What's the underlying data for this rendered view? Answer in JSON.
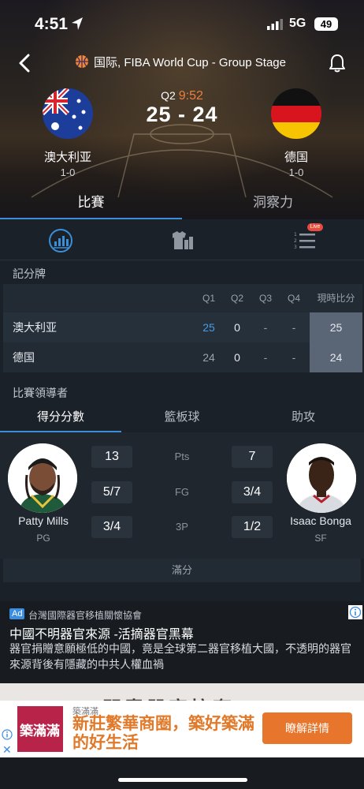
{
  "status_bar": {
    "time": "4:51",
    "network": "5G",
    "battery": "49"
  },
  "header": {
    "league": "国际, FIBA World Cup - Group Stage"
  },
  "match": {
    "period": "Q2",
    "clock": "9:52",
    "score": "25 - 24",
    "home": {
      "name": "澳大利亚",
      "record": "1-0"
    },
    "away": {
      "name": "德国",
      "record": "1-0"
    }
  },
  "main_tabs": [
    {
      "label": "比賽"
    },
    {
      "label": "洞察力"
    }
  ],
  "icon_tabs": {
    "live_badge": "Live"
  },
  "scoreboard": {
    "title": "記分牌",
    "headers": [
      "Q1",
      "Q2",
      "Q3",
      "Q4",
      "現時比分"
    ],
    "rows": [
      {
        "team": "澳大利亚",
        "q1": "25",
        "q2": "0",
        "q3": "-",
        "q4": "-",
        "total": "25"
      },
      {
        "team": "德国",
        "q1": "24",
        "q2": "0",
        "q3": "-",
        "q4": "-",
        "total": "24"
      }
    ]
  },
  "leaders": {
    "title": "比賽領導者",
    "tabs": [
      {
        "label": "得分分數"
      },
      {
        "label": "籃板球"
      },
      {
        "label": "助攻"
      }
    ],
    "home_player": {
      "name": "Patty Mills",
      "position": "PG",
      "stats": [
        "13",
        "5/7",
        "3/4"
      ]
    },
    "away_player": {
      "name": "Isaac Bonga",
      "position": "SF",
      "stats": [
        "7",
        "3/4",
        "1/2"
      ]
    },
    "stat_labels": [
      "Pts",
      "FG",
      "3P"
    ],
    "full_score": "滿分"
  },
  "ad": {
    "badge": "Ad",
    "source": "台灣國際器官移植關懷協會",
    "title": "中國不明器官來源 -活摘器官黑幕",
    "body": "器官捐贈意願極低的中國，竟是全球第二器官移植大國，不透明的器官來源背後有隱藏的中共人權血禍",
    "image_text": "問責器官掠奪"
  },
  "banner": {
    "brand": "築滿滿",
    "logo_text": "築滿滿",
    "headline": "新莊繁華商圈，築好築滿的好生活",
    "cta": "瞭解詳情"
  },
  "colors": {
    "accent": "#3b8fd8",
    "clock": "#f07d3a",
    "cta": "#e8752c"
  }
}
